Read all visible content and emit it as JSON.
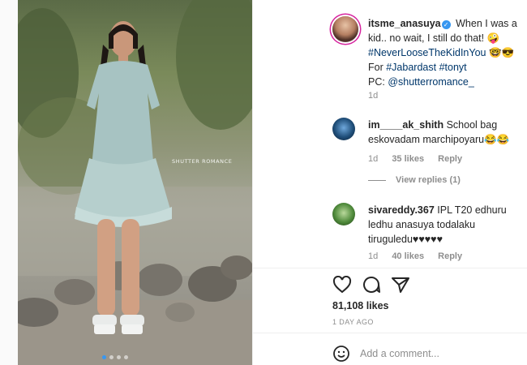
{
  "post": {
    "username": "itsme_anasuya",
    "verified_glyph": "✓",
    "caption_text": "When I was a kid.. no wait, I still do that! 🤪",
    "hashtag_main": "#NeverLooseTheKidInYou",
    "hashtag_emoji": "🤓😎",
    "for_label": "For",
    "hashtag_jabardast": "#Jabardast",
    "hashtag_tonyt": "#tonyt",
    "pc_label": "PC:",
    "photographer": "@shutterromance_",
    "caption_age": "1d",
    "image_watermark": "SHUTTER ROMANCE"
  },
  "comments": [
    {
      "username": "im____ak_shith",
      "text": "School bag eskovadam marchipoyaru😂😂",
      "age": "1d",
      "likes": "35 likes",
      "reply": "Reply",
      "view_replies": "View replies (1)"
    },
    {
      "username": "sivareddy.367",
      "text": "IPL T20 edhuru ledhu anasuya todalaku tiruguledu♥♥♥♥♥",
      "age": "1d",
      "likes": "40 likes",
      "reply": "Reply"
    }
  ],
  "footer": {
    "likes_count": "81,108 likes",
    "time_ago": "1 DAY AGO",
    "add_comment_placeholder": "Add a comment..."
  },
  "icons": {
    "like": "heart-icon",
    "comment": "comment-icon",
    "share": "share-icon",
    "emoji": "emoji-icon",
    "verified": "verified-badge-icon"
  },
  "colors": {
    "link": "#00376b",
    "verified": "#3897f0",
    "muted": "#8e8e8e",
    "text": "#262626"
  }
}
